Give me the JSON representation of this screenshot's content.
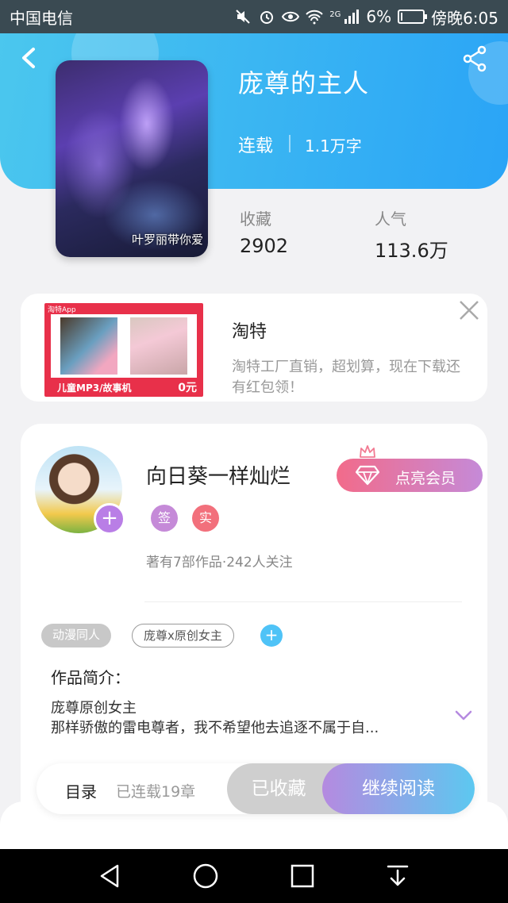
{
  "status_bar": {
    "carrier": "中国电信",
    "network": "2G",
    "battery": "6%",
    "battery_level": 0.06,
    "time": "傍晚6:05"
  },
  "book": {
    "title": "庞尊的主人",
    "status": "连载",
    "word_count": "1.1万字",
    "cover_caption": "叶罗丽带你爱",
    "stats": [
      {
        "label": "收藏",
        "value": "2902"
      },
      {
        "label": "人气",
        "value": "113.6万"
      }
    ]
  },
  "ad": {
    "app_name": "淘特App",
    "banner_text": "儿童MP3/故事机",
    "price": "0元",
    "title": "淘特",
    "description": "淘特工厂直销，超划算，现在下载还\n有红包领！"
  },
  "author": {
    "name": "向日葵一样灿烂",
    "badges": [
      {
        "label": "签",
        "color": "#c58ad8"
      },
      {
        "label": "实",
        "color": "#f2707c"
      }
    ],
    "meta": "著有7部作品·242人关注",
    "vip_label": "点亮会员"
  },
  "tags": [
    "动漫同人",
    "庞尊x原创女主"
  ],
  "intro": {
    "label": "作品简介：",
    "text": "庞尊原创女主\n那样骄傲的雷电尊者，我不希望他去追逐不属于自..."
  },
  "action_bar": {
    "toc_label": "目录",
    "chapter_count": "已连载19章",
    "fav_label": "已收藏",
    "read_label": "继续阅读"
  },
  "colors": {
    "header_start": "#4bc7ee",
    "header_end": "#2aa4f6",
    "vip_start": "#f26b8a",
    "vip_end": "#c58ad8",
    "read_start": "#b58ae0",
    "read_end": "#5cc8f0"
  }
}
